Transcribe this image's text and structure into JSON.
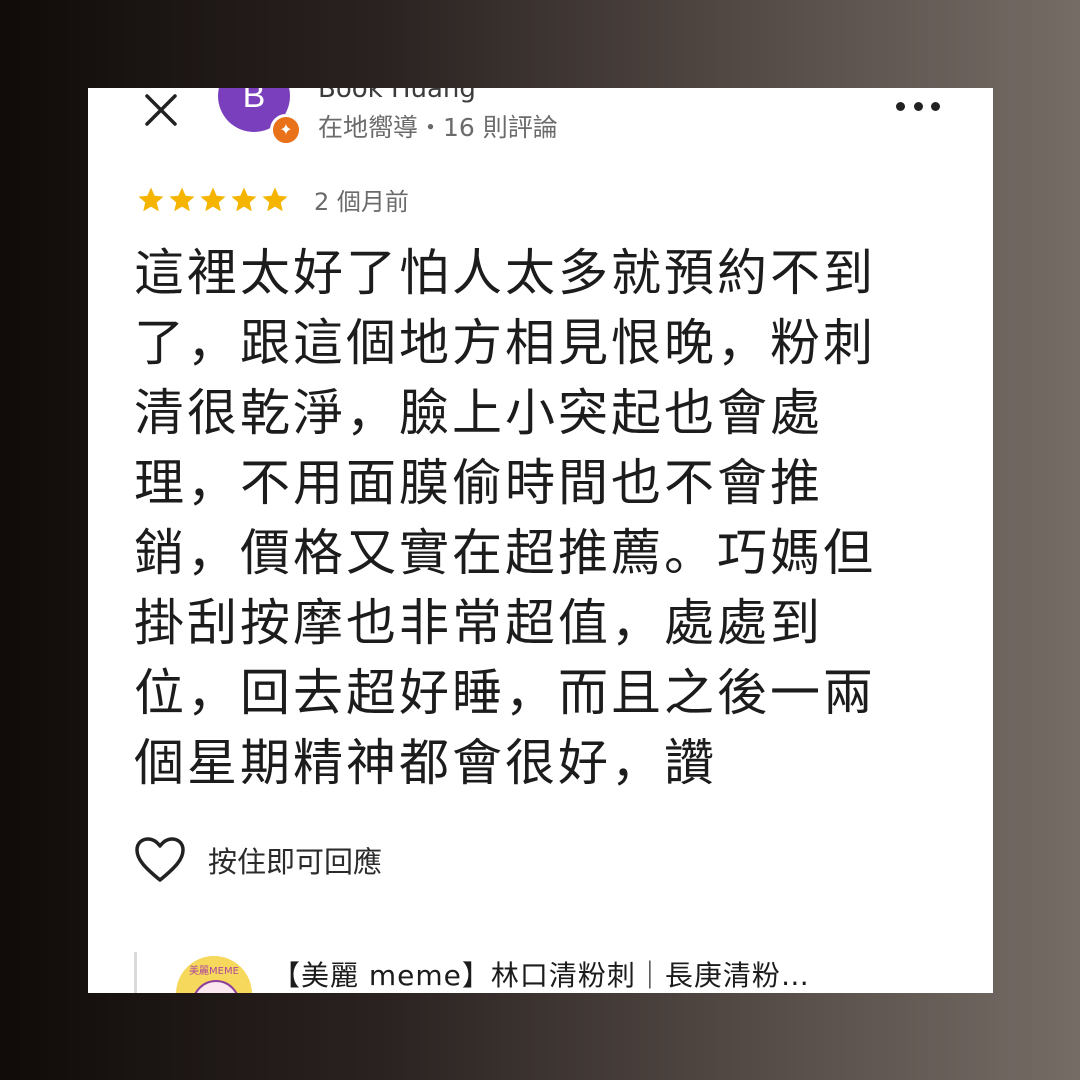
{
  "author": {
    "initial": "B",
    "name": "Book Huang",
    "meta": "在地嚮導・16 則評論"
  },
  "rating": {
    "stars": 5,
    "time": "2 個月前"
  },
  "review": {
    "text": "這裡太好了怕人太多就預約不到了，跟這個地方相見恨晚，粉刺清很乾淨，臉上小突起也會處理，不用面膜偷時間也不會推銷，價格又實在超推薦。巧媽但掛刮按摩也非常超值，處處到位，回去超好睡，而且之後一兩個星期精神都會很好，讚"
  },
  "actions": {
    "reply_label": "按住即可回應"
  },
  "owner": {
    "logo_text": "美麗MEME",
    "name": "【美麗 meme】林口清粉刺｜長庚清粉…"
  },
  "colors": {
    "avatar": "#7a3fbd",
    "badge": "#e8711a",
    "star": "#f4b400"
  },
  "icons": [
    "close-icon",
    "local-guide-icon",
    "more-icon",
    "star-icon",
    "heart-icon"
  ]
}
